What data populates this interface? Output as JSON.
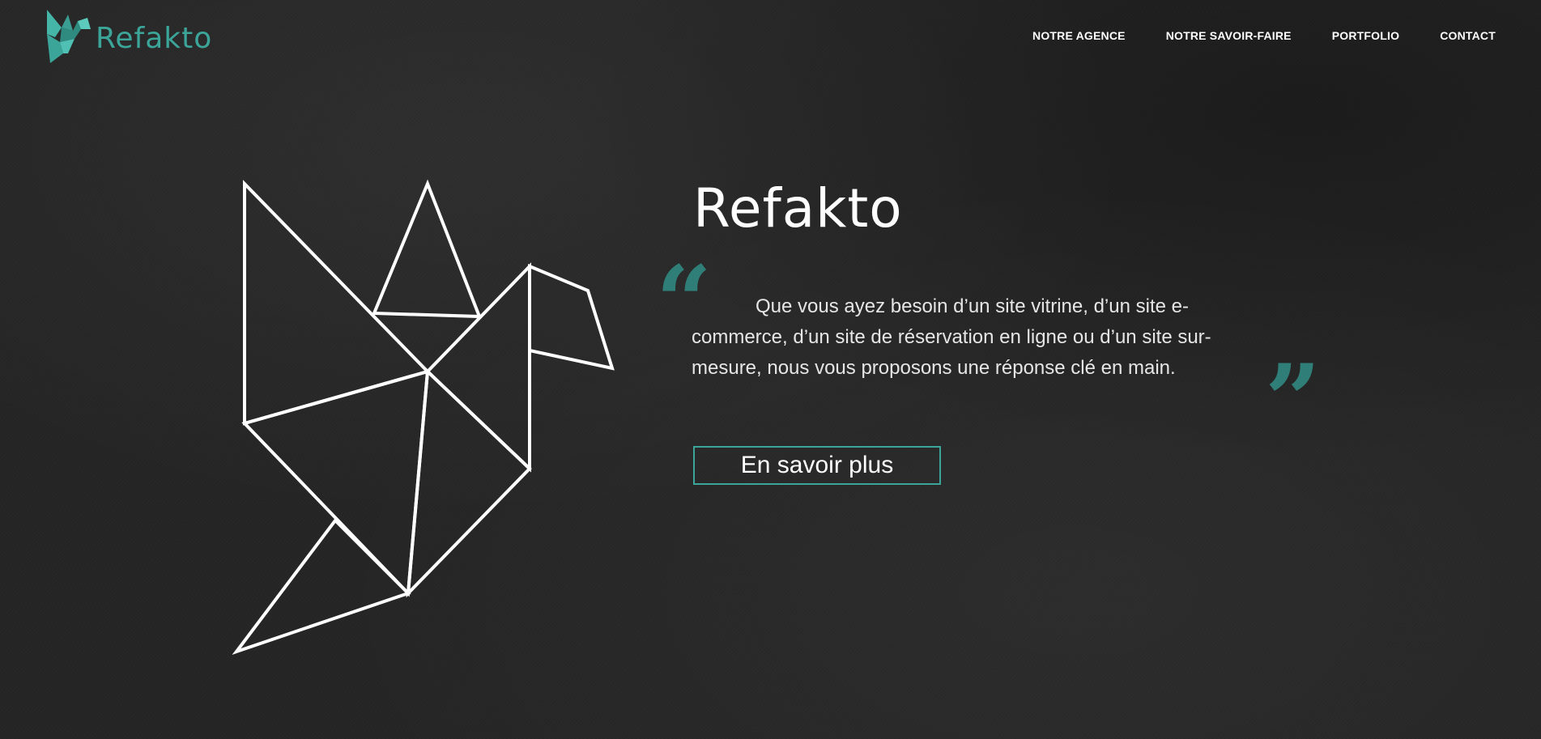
{
  "colors": {
    "background": "#252525",
    "accent": "#3ca59a",
    "quote_accent": "#2f7f78",
    "text": "#ffffff"
  },
  "header": {
    "logo_text": "Refakto",
    "logo_icon": "origami-bird-icon",
    "nav": [
      {
        "label": "NOTRE AGENCE"
      },
      {
        "label": "NOTRE SAVOIR-FAIRE"
      },
      {
        "label": "PORTFOLIO"
      },
      {
        "label": "CONTACT"
      }
    ]
  },
  "hero": {
    "illustration_icon": "origami-crane-icon",
    "title": "Refakto",
    "quote_open": "“",
    "quote_close": "”",
    "text": "Que vous ayez besoin d’un site vitrine, d’un site e-commerce, d’un site de réservation en ligne ou d’un site sur-mesure, nous vous proposons une réponse clé en main.",
    "cta_label": "En savoir plus"
  }
}
